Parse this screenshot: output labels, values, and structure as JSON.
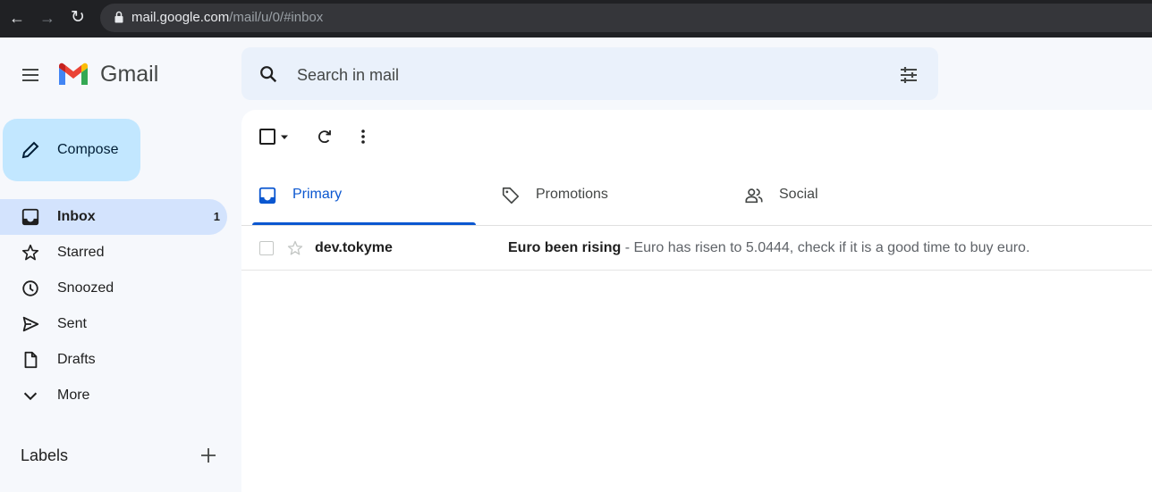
{
  "browser": {
    "url_host": "mail.google.com",
    "url_path": "/mail/u/0/#inbox"
  },
  "header": {
    "brand": "Gmail",
    "search_placeholder": "Search in mail"
  },
  "compose": {
    "label": "Compose"
  },
  "sidebar": {
    "items": [
      {
        "label": "Inbox",
        "icon": "inbox-icon",
        "count": "1",
        "active": true
      },
      {
        "label": "Starred",
        "icon": "star-icon",
        "count": ""
      },
      {
        "label": "Snoozed",
        "icon": "clock-icon",
        "count": ""
      },
      {
        "label": "Sent",
        "icon": "send-icon",
        "count": ""
      },
      {
        "label": "Drafts",
        "icon": "draft-icon",
        "count": ""
      },
      {
        "label": "More",
        "icon": "chevron-down-icon",
        "count": ""
      }
    ],
    "labels_heading": "Labels"
  },
  "tabs": [
    {
      "label": "Primary",
      "icon": "inbox-icon",
      "active": true
    },
    {
      "label": "Promotions",
      "icon": "tag-icon"
    },
    {
      "label": "Social",
      "icon": "people-icon"
    }
  ],
  "emails": [
    {
      "sender": "dev.tokyme",
      "subject": "Euro been rising",
      "separator": " - ",
      "snippet": "Euro has risen to 5.0444, check if it is a good time to buy euro."
    }
  ],
  "colors": {
    "browser_bar": "#202124",
    "app_bg": "#f6f8fc",
    "search_bg": "#eaf1fb",
    "compose_bg": "#c2e7ff",
    "active_nav_bg": "#d3e3fd",
    "accent_blue": "#0b57d0"
  }
}
